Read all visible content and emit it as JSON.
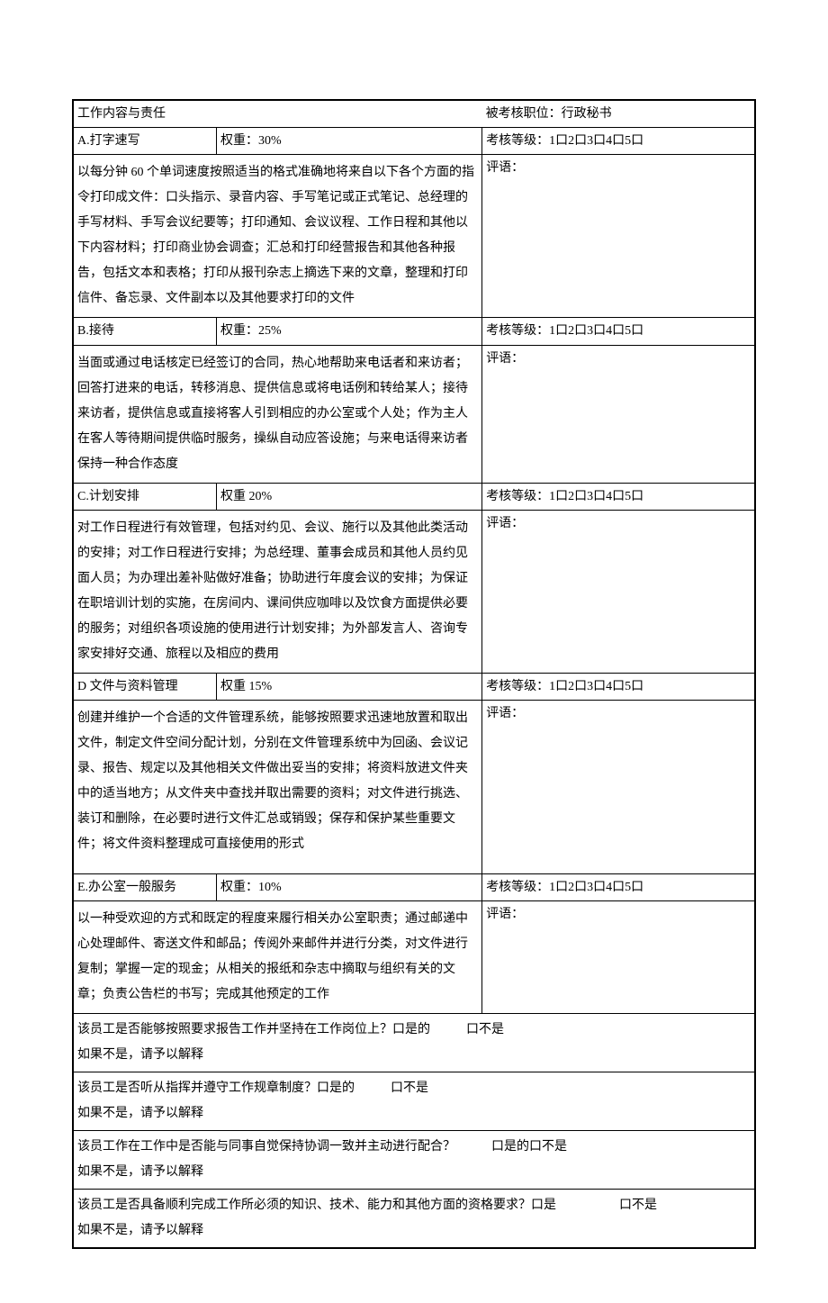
{
  "header": {
    "left_label": "工作内容与责任",
    "right_label": "被考核职位：行政秘书"
  },
  "rating_scale": "考核等级：1口2口3口4口5口",
  "comment_label": "评语：",
  "sections": [
    {
      "code": "A.打字速写",
      "weight": "权重：30%",
      "desc": "以每分钟 60 个单词速度按照适当的格式准确地将来自以下各个方面的指令打印成文件：口头指示、录音内容、手写笔记或正式笔记、总经理的手写材料、手写会议纪要等；打印通知、会议议程、工作日程和其他以下内容材料；打印商业协会调查；汇总和打印经营报告和其他各种报告，包括文本和表格；打印从报刊杂志上摘选下来的文章，整理和打印信件、备忘录、文件副本以及其他要求打印的文件"
    },
    {
      "code": "B.接待",
      "weight": "权重：25%",
      "desc": "当面或通过电话核定已经签订的合同，热心地帮助来电话者和来访者；回答打进来的电话，转移消息、提供信息或将电话例和转给某人；接待来访者，提供信息或直接将客人引到相应的办公室或个人处；作为主人在客人等待期间提供临时服务，操纵自动应答设施；与来电话得来访者保持一种合作态度"
    },
    {
      "code": "C.计划安排",
      "weight": "权重 20%",
      "desc": "对工作日程进行有效管理，包括对约见、会议、施行以及其他此类活动的安排；对工作日程进行安排；为总经理、董事会成员和其他人员约见面人员；为办理出差补贴做好准备；协助进行年度会议的安排；为保证在职培训计划的实施，在房间内、课间供应咖啡以及饮食方面提供必要的服务；对组织各项设施的使用进行计划安排；为外部发言人、咨询专家安排好交通、旅程以及相应的费用"
    },
    {
      "code": "D 文件与资料管理",
      "weight": "权重 15%",
      "desc": "创建并维护一个合适的文件管理系统，能够按照要求迅速地放置和取出文件，制定文件空间分配计划，分别在文件管理系统中为回函、会议记录、报告、规定以及其他相关文件做出妥当的安排；将资料放进文件夹中的适当地方；从文件夹中查找并取出需要的资料；对文件进行挑选、装订和删除，在必要时进行文件汇总或销毁；保存和保护某些重要文件；将文件资料整理成可直接使用的形式"
    },
    {
      "code": "E.办公室一般服务",
      "weight": "权重：10%",
      "desc": "以一种受欢迎的方式和既定的程度来履行相关办公室职责；通过邮递中心处理邮件、寄送文件和邮品；传阅外来邮件并进行分类，对文件进行复制；掌握一定的现金；从相关的报纸和杂志中摘取与组织有关的文章；负责公告栏的书写；完成其他预定的工作"
    }
  ],
  "questions": [
    {
      "text": "该员工是否能够按照要求报告工作并坚持在工作岗位上？口是的",
      "opt_no": "口不是",
      "follow": "如果不是，请予以解释"
    },
    {
      "text": "该员工是否听从指挥并遵守工作规章制度？口是的",
      "opt_no": "口不是",
      "follow": "如果不是，请予以解释"
    },
    {
      "text": "该员工作在工作中是否能与同事自觉保持协调一致并主动进行配合？",
      "opt_yes": "口是的",
      "opt_no": "口不是",
      "follow": "如果不是，请予以解释"
    },
    {
      "text": "该员工是否具备顺利完成工作所必须的知识、技术、能力和其他方面的资格要求？口是",
      "opt_no": "口不是",
      "follow": "如果不是，请予以解释"
    }
  ]
}
